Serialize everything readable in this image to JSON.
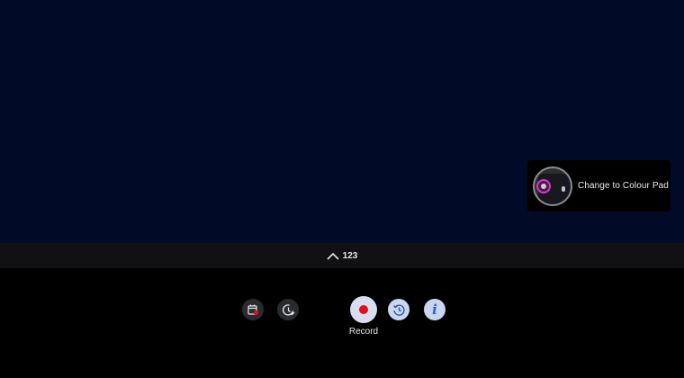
{
  "toast": {
    "text": "Change to Colour Pad",
    "icon": "remote-colour-pad-thumbnail"
  },
  "expand_bar": {
    "label": "123",
    "icon": "chevron-up-icon"
  },
  "controls": {
    "schedule_recording_icon": "calendar-record-icon",
    "timer_icon": "clock-check-icon",
    "record_label": "Record",
    "record_icon": "record-dot-icon",
    "timeshift_icon": "clock-rewind-icon",
    "info_icon": "info-icon"
  },
  "colors": {
    "video_background": "#010a26",
    "record_red": "#e0101b",
    "accent_blue": "#2a60d8",
    "highlight_magenta": "#e02fd1"
  }
}
